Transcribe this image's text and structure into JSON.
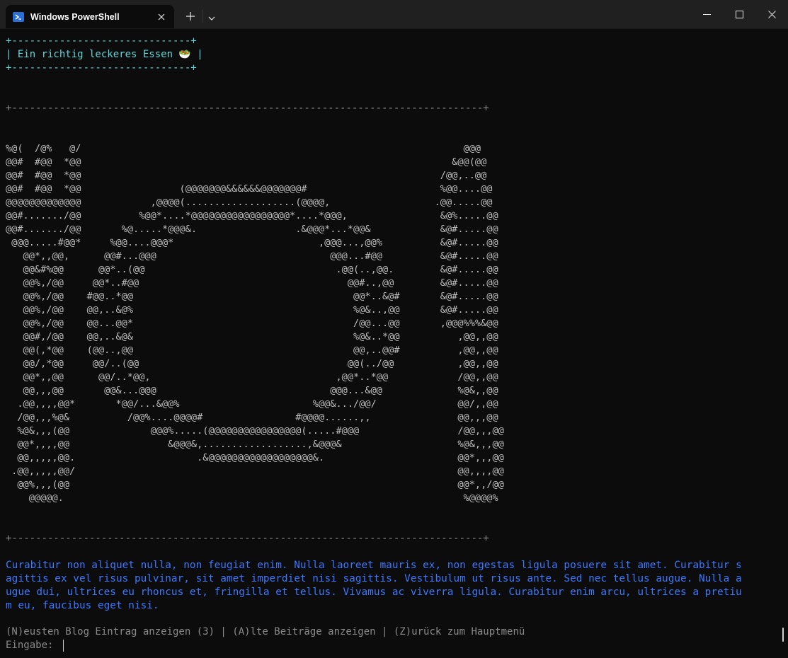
{
  "window": {
    "tab_title": "Windows PowerShell",
    "new_tab_symbol": "+",
    "icons": [
      "powershell-icon",
      "close-icon",
      "plus-icon",
      "chevron-down-icon",
      "minimize-icon",
      "maximize-icon",
      "close-window-icon"
    ]
  },
  "terminal": {
    "header_box": [
      "+------------------------------+",
      "| Ein richtig leckeres Essen 🥗 |",
      "+------------------------------+"
    ],
    "separator_top": "+-------------------------------------------------------------------------------+",
    "ascii_art": [
      "%@(  /@%   @/                                                                  @@@",
      "@@#  #@@  *@@                                                                &@@(@@",
      "@@#  #@@  *@@                                                              /@@,..@@",
      "@@#  #@@  *@@                 (@@@@@@@&&&&&&@@@@@@@#                       %@@....@@",
      "@@@@@@@@@@@@@            ,@@@@(...................(@@@@,                  .@@.....@@",
      "@@#......./@@          %@@*....*@@@@@@@@@@@@@@@@@*....*@@@,                &@%.....@@",
      "@@#......./@@       %@.....*@@@&.                 .&@@@*...*@@&            &@#.....@@",
      " @@@.....#@@*     %@@....@@@*                         ,@@@...,@@%          &@#.....@@",
      "   @@*,,@@,      @@#...@@@                              @@@...#@@          &@#.....@@",
      "   @@&#%@@      @@*..(@@                                 .@@(..,@@.        &@#.....@@",
      "   @@%,/@@     @@*..#@@                                    @@#..,@@        &@#.....@@",
      "   @@%,/@@    #@@..*@@                                      @@*..&@#       &@#.....@@",
      "   @@%,/@@    @@,..&@%                                      %@&..,@@       &@#.....@@",
      "   @@%,/@@    @@...@@*                                      /@@...@@       ,@@@%%%&@@",
      "   @@#,/@@    @@,..&@&                                      %@&..*@@          ,@@,,@@",
      "   @@(,*@@    (@@..,@@                                      @@,..@@#          ,@@,,@@",
      "   @@/,*@@     @@/..(@@                                    @@(../@@           ,@@,,@@",
      "   @@*,,@@      @@/..*@@,                                ,@@*..*@@            /@@,,@@",
      "   @@,,,@@       @@&...@@@                              @@@...&@@             %@&,,@@",
      "  .@@,,,,@@*       *@@/...&@@%                       %@@&.../@@/              @@/,,@@",
      "  /@@,,,%@&          /@@%....@@@@#                #@@@@......,,               @@,,,@@",
      "  %@&,,,(@@              @@@%.....(@@@@@@@@@@@@@@@@(.....#@@@                 /@@,,,@@",
      "  @@*,,,,@@                 &@@@&,..................,&@@@&                    %@&,,,@@",
      "  @@,,,,,@@.                     .&@@@@@@@@@@@@@@@@@@&.                       @@*,,,@@",
      " .@@,,,,,@@/                                                                  @@,,,,@@",
      "  @@%,,,(@@                                                                   @@*,,/@@",
      "    @@@@@.                                                                     %@@@@%"
    ],
    "separator_bottom": "+-------------------------------------------------------------------------------+",
    "paragraph_lines": [
      "Curabitur non aliquet nulla, non feugiat enim. Nulla laoreet mauris ex, non egestas ligula posuere sit amet. Curabitur s",
      "agittis ex vel risus pulvinar, sit amet imperdiet nisi sagittis. Vestibulum ut risus ante. Sed nec tellus augue. Nulla a",
      "ugue dui, ultrices eu rhoncus et, fringilla et tellus. Vivamus ac viverra ligula. Curabitur enim arcu, ultrices a pretiu",
      "m eu, faucibus eget nisi."
    ],
    "menu_line": "(N)eusten Blog Eintrag anzeigen (3) | (A)lte Beiträge anzeigen | (Z)urück zum Hauptmenü",
    "prompt": "Eingabe: "
  },
  "colors": {
    "background": "#0c0c0c",
    "titlebar": "#202020",
    "cyan": "#61d6d6",
    "blue": "#3b78ff",
    "gray": "#8a8a8a"
  }
}
